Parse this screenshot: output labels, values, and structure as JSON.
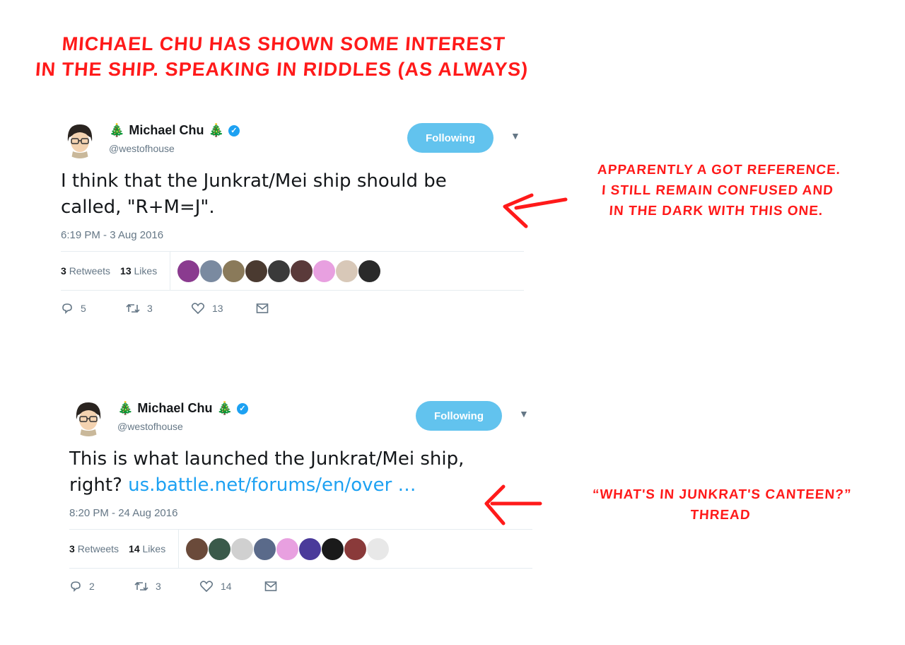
{
  "title_lines": [
    "MICHAEL CHU HAS SHOWN SOME INTEREST",
    "IN THE SHIP. SPEAKING IN RIDDLES (AS ALWAYS)"
  ],
  "tweets": [
    {
      "display_name": "Michael Chu",
      "handle": "@westofhouse",
      "follow_label": "Following",
      "text_line1": "I think that the Junkrat/Mei ship should be",
      "text_line2": "called, \"R+M=J\".",
      "link": "",
      "timestamp": "6:19 PM - 3 Aug 2016",
      "retweets_count": "3",
      "retweets_label": "Retweets",
      "likes_count": "13",
      "likes_label": "Likes",
      "reply_count": "5",
      "retweet_action_count": "3",
      "like_action_count": "13",
      "face_colors": [
        "#8a3b8f",
        "#7a8aa0",
        "#8a7a5a",
        "#4a3a30",
        "#3a3a3a",
        "#5a3a3a",
        "#e8a0e0",
        "#d8c8b8",
        "#2a2a2a"
      ]
    },
    {
      "display_name": "Michael Chu",
      "handle": "@westofhouse",
      "follow_label": "Following",
      "text_line1": "This is what launched the Junkrat/Mei ship,",
      "text_line2": "right?",
      "link": "us.battle.net/forums/en/over …",
      "timestamp": "8:20 PM - 24 Aug 2016",
      "retweets_count": "3",
      "retweets_label": "Retweets",
      "likes_count": "14",
      "likes_label": "Likes",
      "reply_count": "2",
      "retweet_action_count": "3",
      "like_action_count": "14",
      "face_colors": [
        "#6a4a3a",
        "#3a5a4a",
        "#d0d0d0",
        "#5a6a8a",
        "#e8a0e0",
        "#4a3a9a",
        "#1a1a1a",
        "#8a3a3a",
        "#e8e8e8"
      ]
    }
  ],
  "notes": {
    "note1": [
      "APPARENTLY A GOT REFERENCE.",
      "I STILL REMAIN CONFUSED AND",
      "IN THE DARK WITH THIS ONE."
    ],
    "note2": [
      "“WHAT'S IN JUNKRAT'S CANTEEN?”",
      "THREAD"
    ]
  },
  "colors": {
    "annotation": "#ff1a1a",
    "follow_button": "#62c3ee",
    "link": "#1da1f2",
    "verified": "#1da1f2"
  },
  "icons": [
    "reply-icon",
    "retweet-icon",
    "like-icon",
    "message-icon",
    "verified-icon",
    "chevron-down-icon",
    "tree-icon"
  ]
}
